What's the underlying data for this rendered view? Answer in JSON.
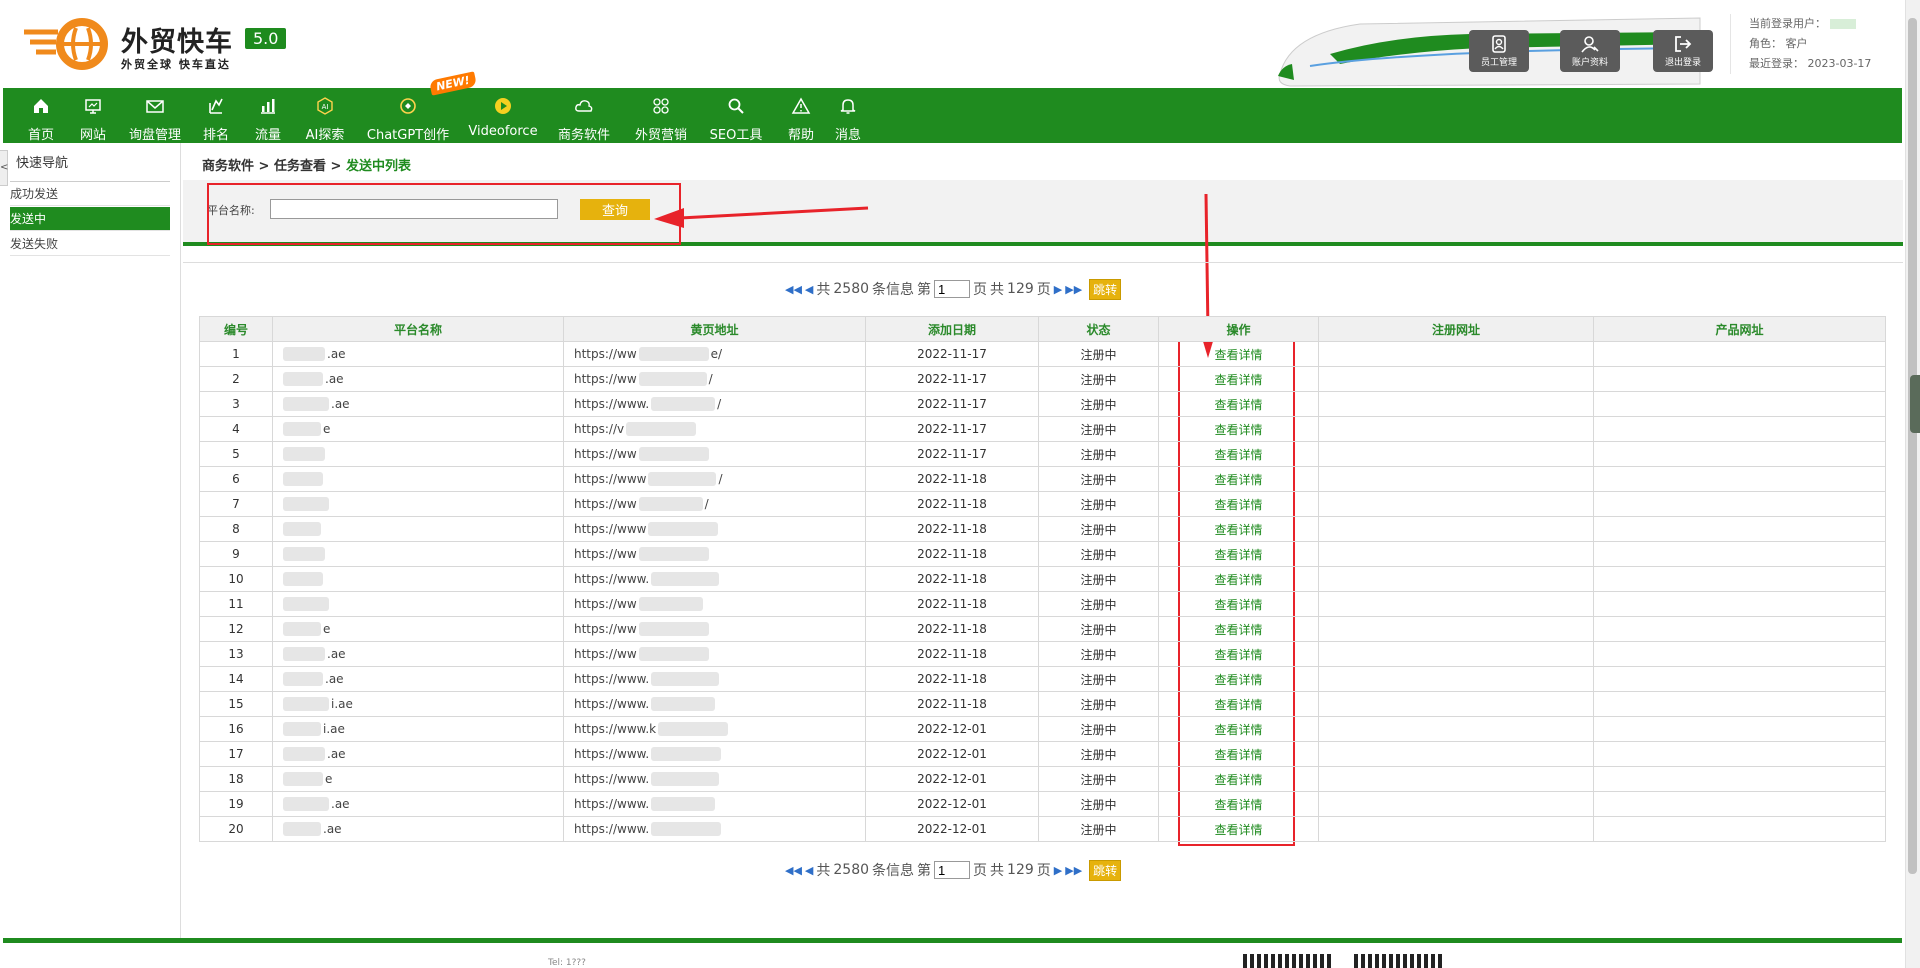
{
  "header": {
    "brand_title": "外贸快车",
    "brand_version": "5.0",
    "brand_slogan": "外贸全球 快车直达",
    "buttons": [
      {
        "label": "员工管理",
        "icon": "staff-icon"
      },
      {
        "label": "账户资料",
        "icon": "account-icon"
      },
      {
        "label": "退出登录",
        "icon": "logout-icon"
      }
    ],
    "user": {
      "current_user_label": "当前登录用户：",
      "role_label": "角色：",
      "role": "客户",
      "last_login_label": "最近登录：",
      "last_login": "2023-03-17"
    }
  },
  "nav": {
    "new_badge": "NEW!",
    "items": [
      {
        "label": "首页",
        "icon": "home-icon"
      },
      {
        "label": "网站",
        "icon": "monitor-icon"
      },
      {
        "label": "询盘管理",
        "icon": "mail-icon"
      },
      {
        "label": "排名",
        "icon": "ranking-icon"
      },
      {
        "label": "流量",
        "icon": "bar-chart-icon"
      },
      {
        "label": "AI探索",
        "icon": "ai-icon"
      },
      {
        "label": "ChatGPT创作",
        "icon": "chatgpt-icon"
      },
      {
        "label": "Videoforce",
        "icon": "video-icon"
      },
      {
        "label": "商务软件",
        "icon": "cloud-icon"
      },
      {
        "label": "外贸营销",
        "icon": "grid-icon"
      },
      {
        "label": "SEO工具",
        "icon": "search-icon"
      },
      {
        "label": "帮助",
        "icon": "warning-icon"
      },
      {
        "label": "消息",
        "icon": "bell-icon"
      }
    ]
  },
  "sidebar": {
    "toggle": "<",
    "title": "快速导航",
    "items": [
      {
        "label": "成功发送",
        "active": false
      },
      {
        "label": "发送中",
        "active": true
      },
      {
        "label": "发送失败",
        "active": false
      }
    ]
  },
  "breadcrumb": {
    "part1": "商务软件",
    "sep": " > ",
    "part2": "任务查看",
    "current": "发送中列表"
  },
  "search": {
    "label": "平台名称:",
    "value": "",
    "button": "查询"
  },
  "pager": {
    "total_prefix": "共",
    "total": "2580",
    "total_suffix": "条信息",
    "page_prefix": "第",
    "page": "1",
    "page_suffix": "页",
    "pages_prefix": "共",
    "pages": "129",
    "pages_suffix": "页",
    "go": "跳转"
  },
  "table": {
    "headers": [
      "编号",
      "平台名称",
      "黄页地址",
      "添加日期",
      "状态",
      "操作",
      "注册网址",
      "产品网址"
    ],
    "action_label": "查看详情",
    "rows": [
      {
        "id": "1",
        "name": ".ae",
        "url": "https://ww",
        "url_tail": "e/",
        "date": "2022-11-17",
        "status": "注册中"
      },
      {
        "id": "2",
        "name": ".ae",
        "url": "https://ww",
        "url_tail": "/",
        "date": "2022-11-17",
        "status": "注册中"
      },
      {
        "id": "3",
        "name": ".ae",
        "url": "https://www.",
        "url_tail": "/",
        "date": "2022-11-17",
        "status": "注册中"
      },
      {
        "id": "4",
        "name": "e",
        "url": "https://v",
        "url_tail": "",
        "date": "2022-11-17",
        "status": "注册中"
      },
      {
        "id": "5",
        "name": "",
        "url": "https://ww",
        "url_tail": "",
        "date": "2022-11-17",
        "status": "注册中"
      },
      {
        "id": "6",
        "name": "",
        "url": "https://www",
        "url_tail": "/",
        "date": "2022-11-18",
        "status": "注册中"
      },
      {
        "id": "7",
        "name": "",
        "url": "https://ww",
        "url_tail": "/",
        "date": "2022-11-18",
        "status": "注册中"
      },
      {
        "id": "8",
        "name": "",
        "url": "https://www",
        "url_tail": "",
        "date": "2022-11-18",
        "status": "注册中"
      },
      {
        "id": "9",
        "name": "",
        "url": "https://ww",
        "url_tail": "",
        "date": "2022-11-18",
        "status": "注册中"
      },
      {
        "id": "10",
        "name": "",
        "url": "https://www.",
        "url_tail": "",
        "date": "2022-11-18",
        "status": "注册中"
      },
      {
        "id": "11",
        "name": "",
        "url": "https://ww",
        "url_tail": "",
        "date": "2022-11-18",
        "status": "注册中"
      },
      {
        "id": "12",
        "name": "e",
        "url": "https://ww",
        "url_tail": "",
        "date": "2022-11-18",
        "status": "注册中"
      },
      {
        "id": "13",
        "name": ".ae",
        "url": "https://ww",
        "url_tail": "",
        "date": "2022-11-18",
        "status": "注册中"
      },
      {
        "id": "14",
        "name": ".ae",
        "url": "https://www.",
        "url_tail": "",
        "date": "2022-11-18",
        "status": "注册中"
      },
      {
        "id": "15",
        "name": "i.ae",
        "url": "https://www.",
        "url_tail": "",
        "date": "2022-11-18",
        "status": "注册中"
      },
      {
        "id": "16",
        "name": "i.ae",
        "url": "https://www.k",
        "url_tail": "",
        "date": "2022-12-01",
        "status": "注册中"
      },
      {
        "id": "17",
        "name": ".ae",
        "url": "https://www.",
        "url_tail": "",
        "date": "2022-12-01",
        "status": "注册中"
      },
      {
        "id": "18",
        "name": "e",
        "url": "https://www.",
        "url_tail": "",
        "date": "2022-12-01",
        "status": "注册中"
      },
      {
        "id": "19",
        "name": ".ae",
        "url": "https://www.",
        "url_tail": "",
        "date": "2022-12-01",
        "status": "注册中"
      },
      {
        "id": "20",
        "name": ".ae",
        "url": "https://www.",
        "url_tail": "",
        "date": "2022-12-01",
        "status": "注册中"
      }
    ]
  },
  "footer": {
    "text": "Tel: 1???"
  },
  "colors": {
    "brand_green": "#1f8b1f",
    "accent_yellow": "#e6b20d",
    "annotation_red": "#e8232a",
    "logo_orange": "#f08a1c"
  }
}
